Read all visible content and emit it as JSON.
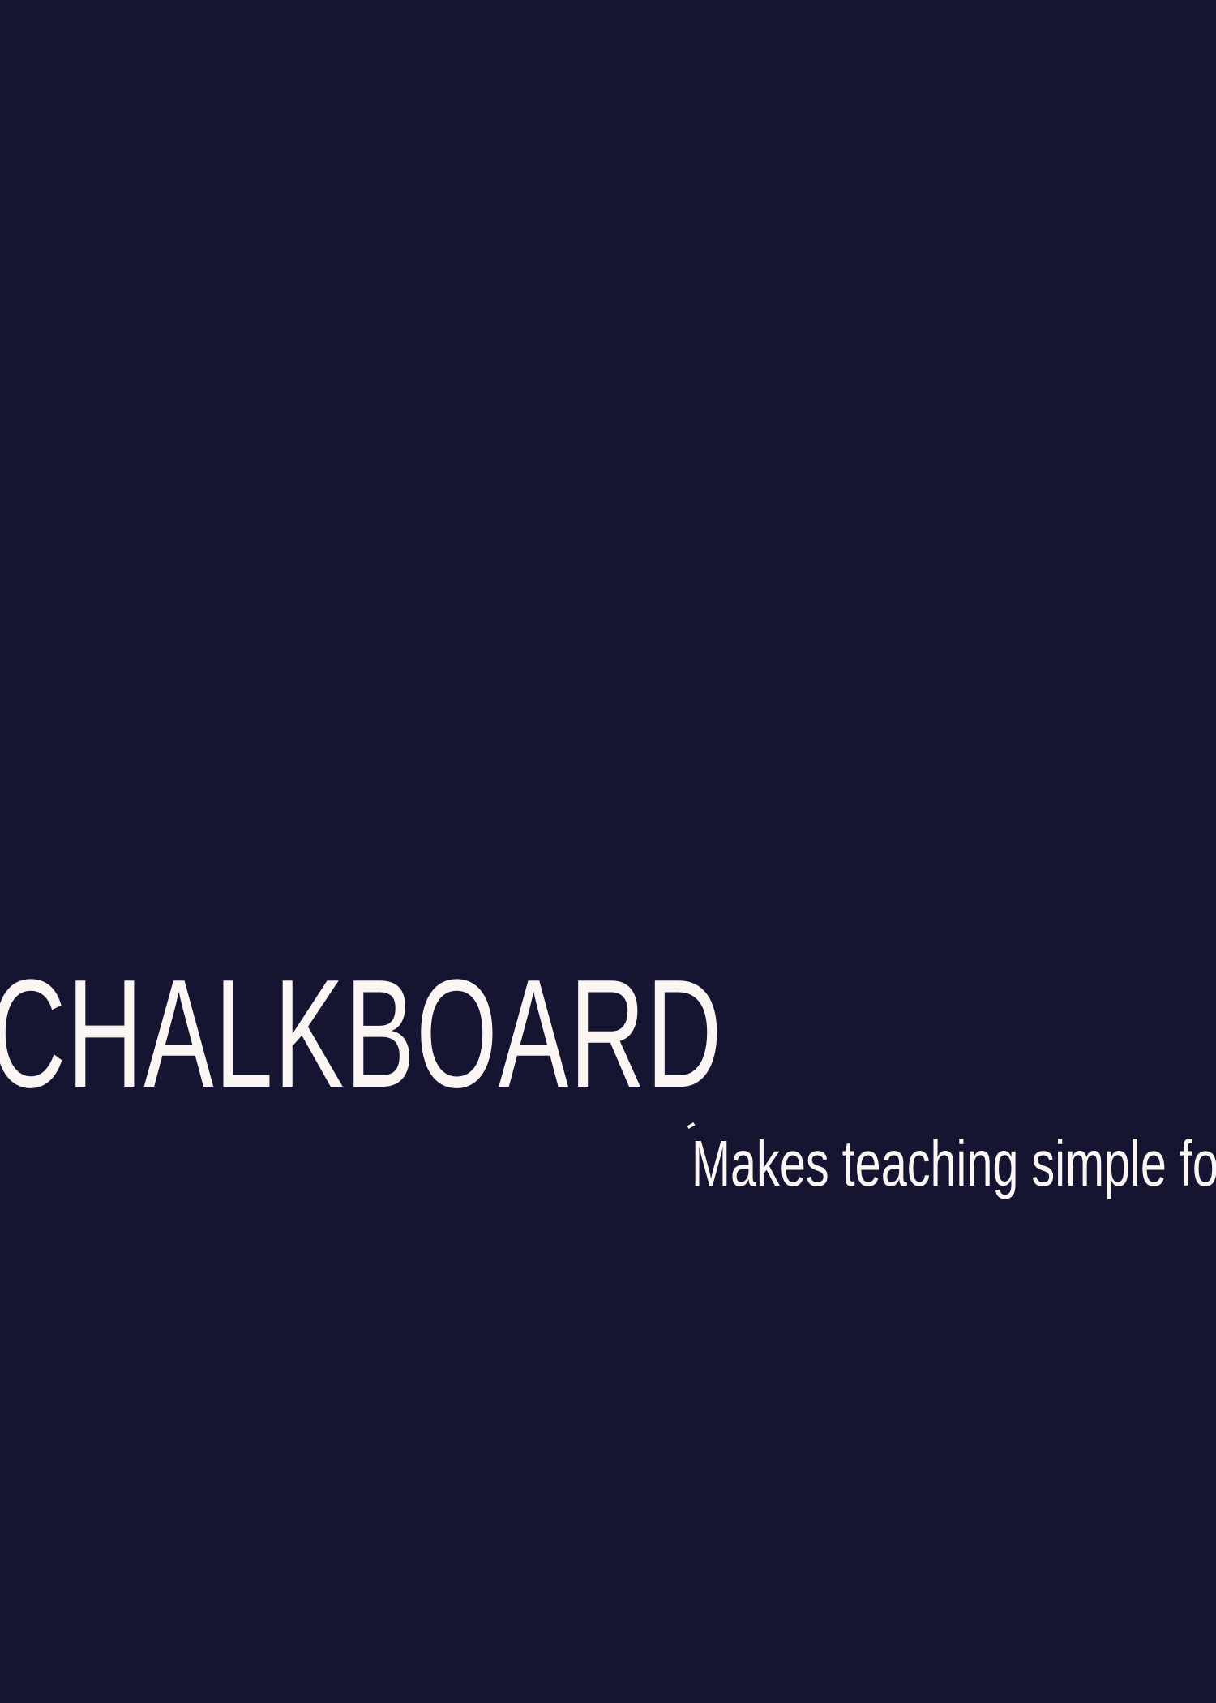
{
  "colors": {
    "background": "#151532",
    "text": "#fbf5f3"
  },
  "hero": {
    "title": "CHALKBOARD",
    "tagline": "Makes teaching simple fo"
  }
}
